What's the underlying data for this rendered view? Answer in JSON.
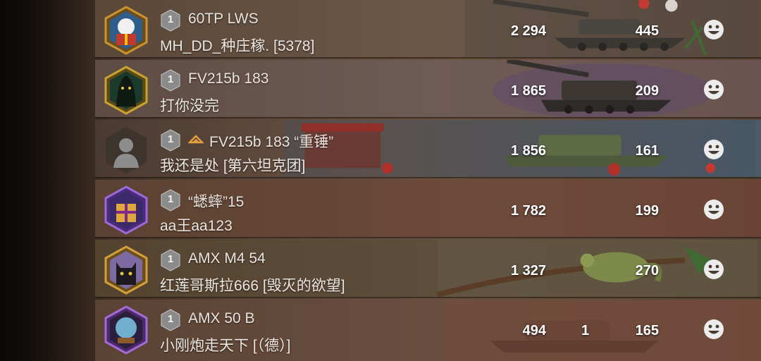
{
  "rows": [
    {
      "rank": "1",
      "tank": "60TP LWS",
      "player": "MH_DD_种庄稼. [5378]",
      "damage": "2 294",
      "kills": "",
      "exp": "445",
      "clan_marker": false,
      "row_color": "#6b5849",
      "avatar_theme": "gift"
    },
    {
      "rank": "1",
      "tank": "FV215b 183",
      "player": "打你没完",
      "damage": "1 865",
      "kills": "",
      "exp": "209",
      "clan_marker": false,
      "row_color": "#6f5b55",
      "avatar_theme": "hooded"
    },
    {
      "rank": "1",
      "tank": "FV215b 183 “重锤”",
      "player": "我还是处 [第六坦克团]",
      "damage": "1 856",
      "kills": "",
      "exp": "161",
      "clan_marker": true,
      "row_color": "#6a5142",
      "avatar_theme": "default-silhouette"
    },
    {
      "rank": "1",
      "tank": "“蟋蟀”15",
      "player": "aa王aa123",
      "damage": "1 782",
      "kills": "",
      "exp": "199",
      "clan_marker": false,
      "row_color": "#6e4a3a",
      "avatar_theme": "present"
    },
    {
      "rank": "1",
      "tank": "AMX M4 54",
      "player": "红莲哥斯拉666 [毁灭的欲望]",
      "damage": "1 327",
      "kills": "",
      "exp": "270",
      "clan_marker": false,
      "row_color": "#5f4d3c",
      "avatar_theme": "cat"
    },
    {
      "rank": "1",
      "tank": "AMX 50 B",
      "player": "小刚炮走天下 [（德）]",
      "damage": "494",
      "kills": "1",
      "exp": "165",
      "clan_marker": false,
      "row_color": "#6a4e3f",
      "avatar_theme": "snowglobe"
    }
  ],
  "icons": {
    "rank_badge": "rank-hex-icon",
    "clan": "clan-chevron-icon",
    "reaction": "smiley-icon"
  },
  "colors": {
    "accent": "#e5a040",
    "rank_badge": "#8b8b8b",
    "text": "#ece7e1"
  }
}
